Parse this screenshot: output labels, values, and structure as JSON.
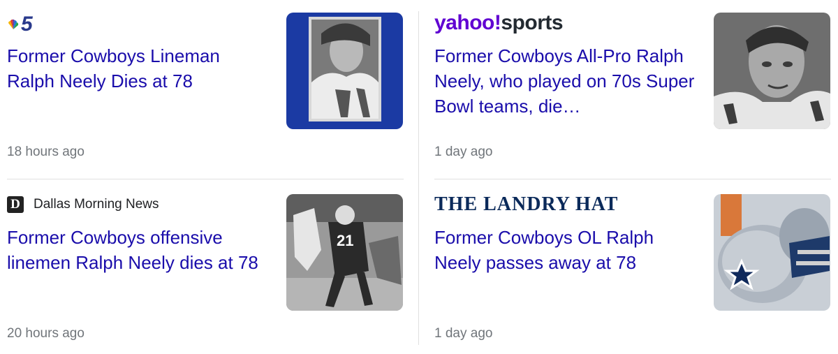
{
  "articles": [
    {
      "source": "NBC 5",
      "source_mark": "5",
      "headline": "Former Cowboys Lineman Ralph Neely Dies at 78",
      "time": "18 hours ago",
      "thumb_icon": "player-portrait-icon"
    },
    {
      "source_part1": "yahoo",
      "source_part2": "sports",
      "source_bang": "!",
      "headline": "Former Cowboys All-Pro Ralph Neely, who played on 70s Super Bowl teams, die…",
      "time": "1 day ago",
      "thumb_icon": "player-closeup-icon"
    },
    {
      "source_mark": "D",
      "source": "Dallas Morning News",
      "headline": "Former Cowboys offensive linemen Ralph Neely dies at 78",
      "time": "20 hours ago",
      "thumb_icon": "football-game-icon"
    },
    {
      "source": "THE LANDRY HAT",
      "headline": "Former Cowboys OL Ralph Neely passes away at 78",
      "time": "1 day ago",
      "thumb_icon": "cowboys-helmet-icon"
    }
  ],
  "colors": {
    "headline": "#1a0dab",
    "time": "#70757a",
    "yahoo_purple": "#6001d2",
    "nbc_blue": "#2a3a8c"
  }
}
